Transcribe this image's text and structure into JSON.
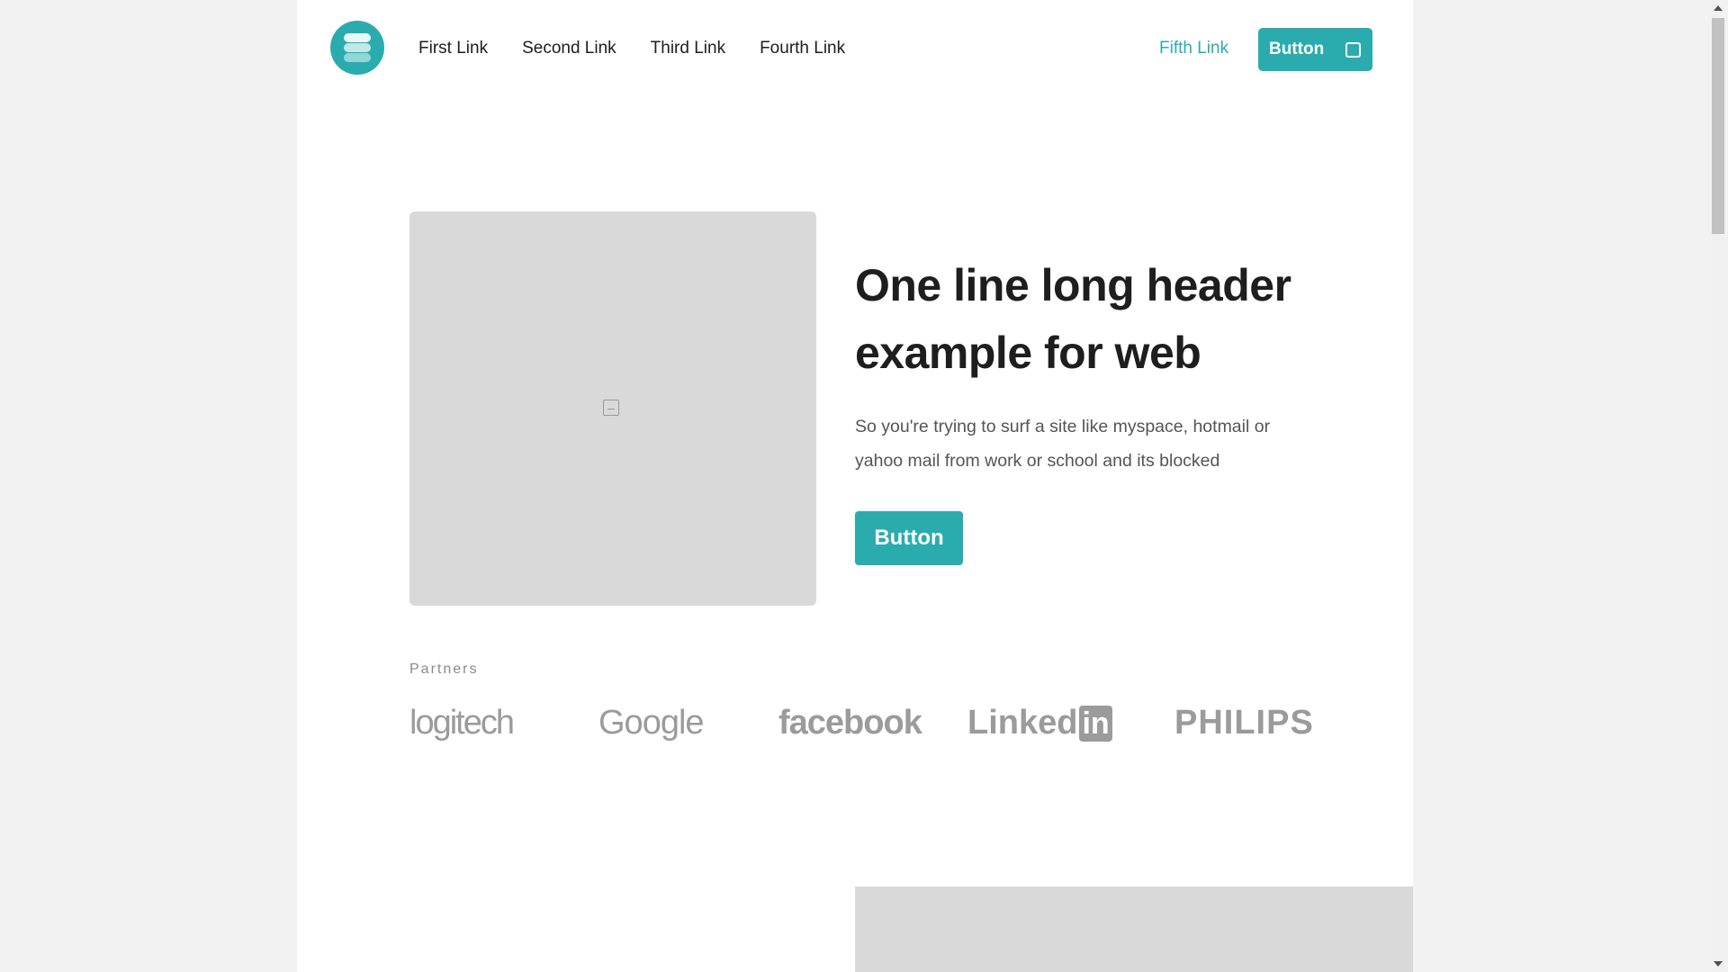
{
  "colors": {
    "accent": "#2aacaf",
    "text": "#1e1e1e",
    "muted": "#555555",
    "placeholder": "#d9d9d9"
  },
  "header": {
    "nav": [
      "First Link",
      "Second Link",
      "Third Link",
      "Fourth Link"
    ],
    "fifth_link": "Fifth Link",
    "button_label": "Button",
    "button_icon": "square-icon"
  },
  "hero": {
    "title": "One line long header example for web",
    "description": "So you're trying to surf a site like myspace, hotmail or yahoo mail from work or school and its blocked",
    "button_label": "Button",
    "image_icon": "image-placeholder-icon"
  },
  "partners": {
    "label": "Partners",
    "logos": [
      "logitech",
      "Google",
      "facebook",
      "Linked",
      "in",
      "PHILIPS"
    ]
  }
}
